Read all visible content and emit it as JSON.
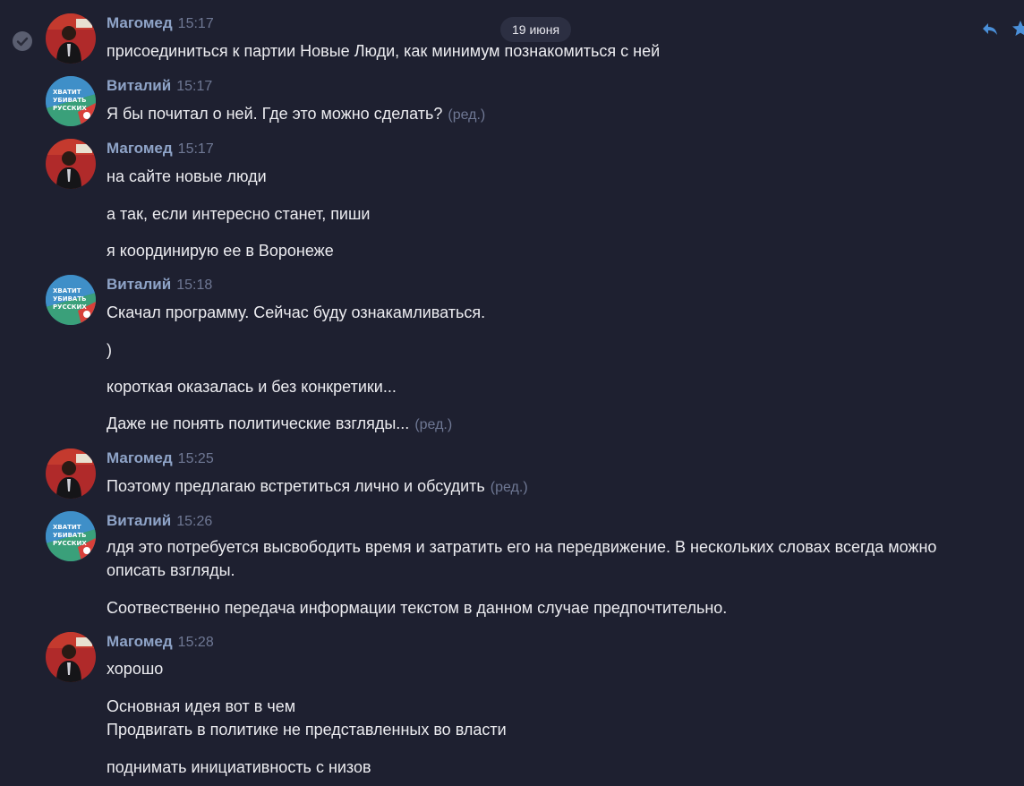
{
  "date_separator": "19 июня",
  "edited_label": "(ред.)",
  "icons": {
    "read_check": "check-circle-icon",
    "reply": "reply-icon",
    "star": "star-icon"
  },
  "colors": {
    "background": "#1e2030",
    "author": "#8fa4c8",
    "muted": "#6f7894",
    "text": "#ececf0",
    "accent": "#4a8fd8"
  },
  "messages": [
    {
      "author": "Магомед",
      "time": "15:17",
      "lines": [
        "присоединиться к партии Новые Люди, как минимум познакомиться с ней"
      ]
    },
    {
      "author": "Виталий",
      "time": "15:17",
      "lines": [
        "Я бы почитал о ней. Где это можно сделать?"
      ],
      "edited_first": true
    },
    {
      "author": "Магомед",
      "time": "15:17",
      "lines": [
        "на сайте новые люди",
        "а так, если интересно станет, пиши",
        "я координирую ее в Воронеже"
      ]
    },
    {
      "author": "Виталий",
      "time": "15:18",
      "lines": [
        "Скачал программу. Сейчас буду ознакамливаться.",
        ")",
        "короткая оказалась и без конкретики...",
        "Даже не понять политические взгляды..."
      ]
    },
    {
      "author": "Магомед",
      "time": "15:25",
      "lines": [
        "Поэтому предлагаю встретиться лично и обсудить"
      ]
    },
    {
      "author": "Виталий",
      "time": "15:26",
      "lines": [
        "лдя это потребуется высвободить время и затратить его на передвижение. В нескольких словах всегда можно описать взгляды.",
        "Соотвественно передача информации текстом в данном случае предпочтительно."
      ]
    },
    {
      "author": "Магомед",
      "time": "15:28",
      "lines": [
        "хорошо",
        "Основная идея вот в чем",
        "Продвигать в политике не представленных во власти",
        "поднимать инициативность с низов"
      ]
    }
  ],
  "avatar_texts": {
    "vitaly": [
      "ХВАТИТ",
      "УБИВАТЬ",
      "РУССКИХ"
    ]
  }
}
